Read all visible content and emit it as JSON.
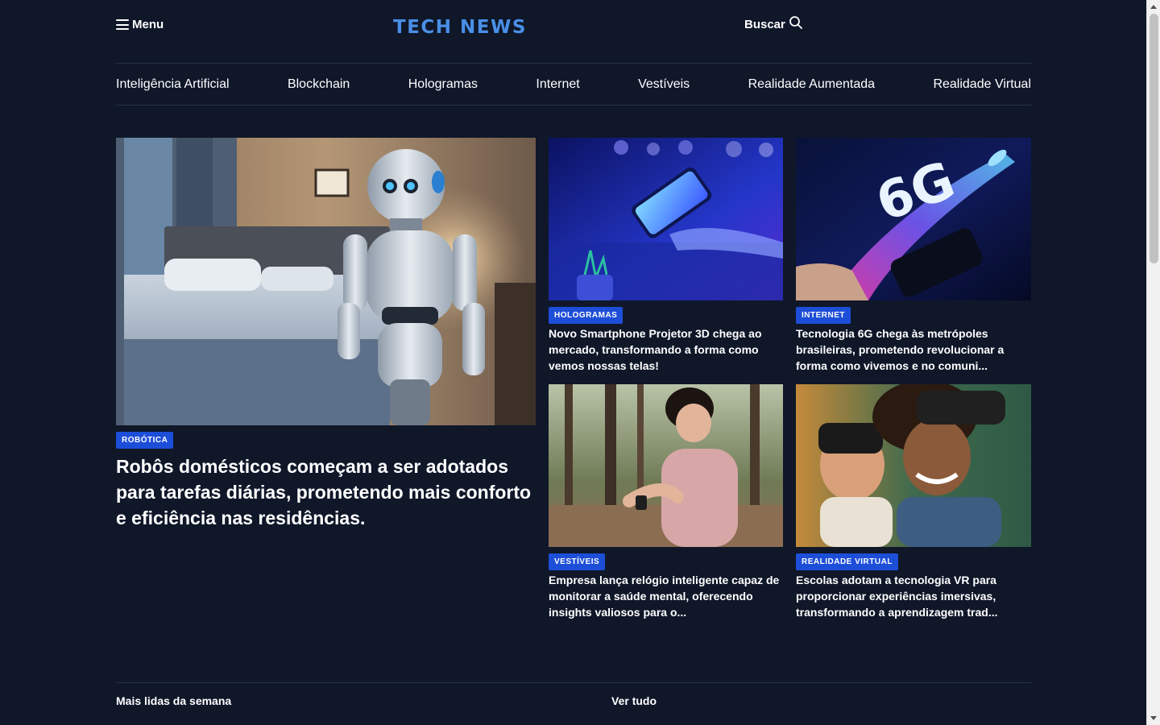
{
  "header": {
    "menu_label": "Menu",
    "logo": "TECH NEWS",
    "search_label": "Buscar"
  },
  "nav": {
    "categories": [
      "Inteligência Artificial",
      "Blockchain",
      "Hologramas",
      "Internet",
      "Vestíveis",
      "Realidade Aumentada",
      "Realidade Virtual"
    ]
  },
  "featured": {
    "badge": "ROBÓTICA",
    "title": "Robôs domésticos começam a ser adotados para tarefas diárias, prometendo mais conforto e eficiência nas residências.",
    "image": "robot-in-bedroom"
  },
  "cards": [
    {
      "badge": "HOLOGRAMAS",
      "title": "Novo Smartphone Projetor 3D chega ao mercado, transformando a forma como vemos nossas telas!",
      "image": "hand-holding-glowing-phone"
    },
    {
      "badge": "INTERNET",
      "title": "Tecnologia 6G chega às metrópoles brasileiras, prometendo revolucionar a forma como vivemos e no comuni...",
      "image": "6g-rocket-phone",
      "image_text": "6G"
    },
    {
      "badge": "VESTÍVEIS",
      "title": "Empresa lança relógio inteligente capaz de monitorar a saúde mental, oferecendo insights valiosos para o...",
      "image": "woman-checking-smartwatch-in-forest"
    },
    {
      "badge": "REALIDADE VIRTUAL",
      "title": "Escolas adotam a tecnologia VR para proporcionar experiências imersivas, transformando a aprendizagem trad...",
      "image": "kids-with-vr-headsets"
    }
  ],
  "section": {
    "title": "Mais lidas da semana",
    "see_all": "Ver tudo"
  },
  "colors": {
    "background": "#0f1729",
    "logo": "#4a8fe7",
    "badge": "#1d4ed8",
    "divider": "#263248"
  }
}
